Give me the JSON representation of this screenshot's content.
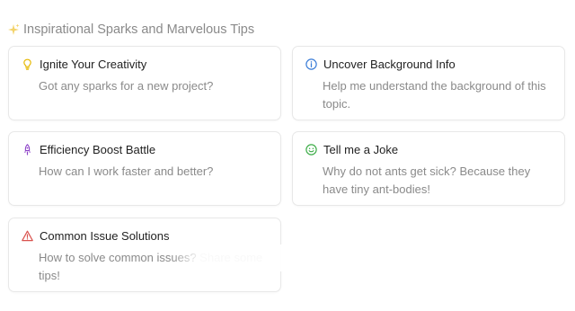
{
  "header": {
    "title": "Inspirational Sparks and Marvelous Tips",
    "icon": "sparkle-icon"
  },
  "cards": [
    {
      "title": "Ignite Your Creativity",
      "description": "Got any sparks for a new project?",
      "icon": "lightbulb-icon",
      "icon_color": "#e6b800"
    },
    {
      "title": "Uncover Background Info",
      "description": "Help me understand the background of this topic.",
      "icon": "info-icon",
      "icon_color": "#3b7dd8"
    },
    {
      "title": "Efficiency Boost Battle",
      "description": "How can I work faster and better?",
      "icon": "rocket-icon",
      "icon_color": "#8e44c8"
    },
    {
      "title": "Tell me a Joke",
      "description": "Why do not ants get sick? Because they have tiny ant-bodies!",
      "icon": "smile-icon",
      "icon_color": "#3fae4a"
    },
    {
      "title": "Common Issue Solutions",
      "description": "How to solve common issues? Share some tips!",
      "icon": "warning-icon",
      "icon_color": "#d9534f"
    }
  ]
}
